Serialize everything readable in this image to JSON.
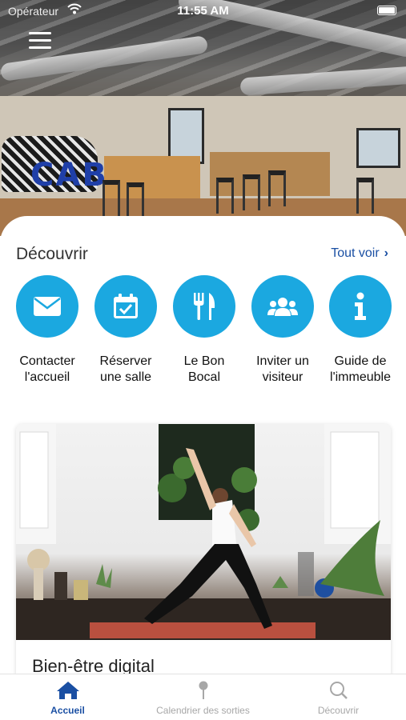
{
  "status_bar": {
    "carrier": "Opérateur",
    "time": "11:55 AM"
  },
  "discover": {
    "title": "Découvrir",
    "see_all": "Tout voir",
    "shortcuts": [
      {
        "icon": "envelope-icon",
        "label": "Contacter\nl'accueil"
      },
      {
        "icon": "calendar-check-icon",
        "label": "Réserver\nune salle"
      },
      {
        "icon": "fork-knife-icon",
        "label": "Le Bon\nBocal"
      },
      {
        "icon": "users-icon",
        "label": "Inviter un\nvisiteur"
      },
      {
        "icon": "info-icon",
        "label": "Guide de\nl'immeuble"
      }
    ]
  },
  "hero": {
    "sign_text": "CAB"
  },
  "featured": {
    "title": "Bien-être digital"
  },
  "tabbar": {
    "active_color": "#1a4fa3",
    "inactive_color": "#a7a7a7",
    "items": [
      {
        "icon": "home-icon",
        "label": "Accueil",
        "active": true
      },
      {
        "icon": "pin-icon",
        "label": "Calendrier des sorties",
        "active": false
      },
      {
        "icon": "search-icon",
        "label": "Découvrir",
        "active": false
      }
    ]
  },
  "colors": {
    "accent": "#1ba8e0",
    "link": "#1a4fa3"
  }
}
